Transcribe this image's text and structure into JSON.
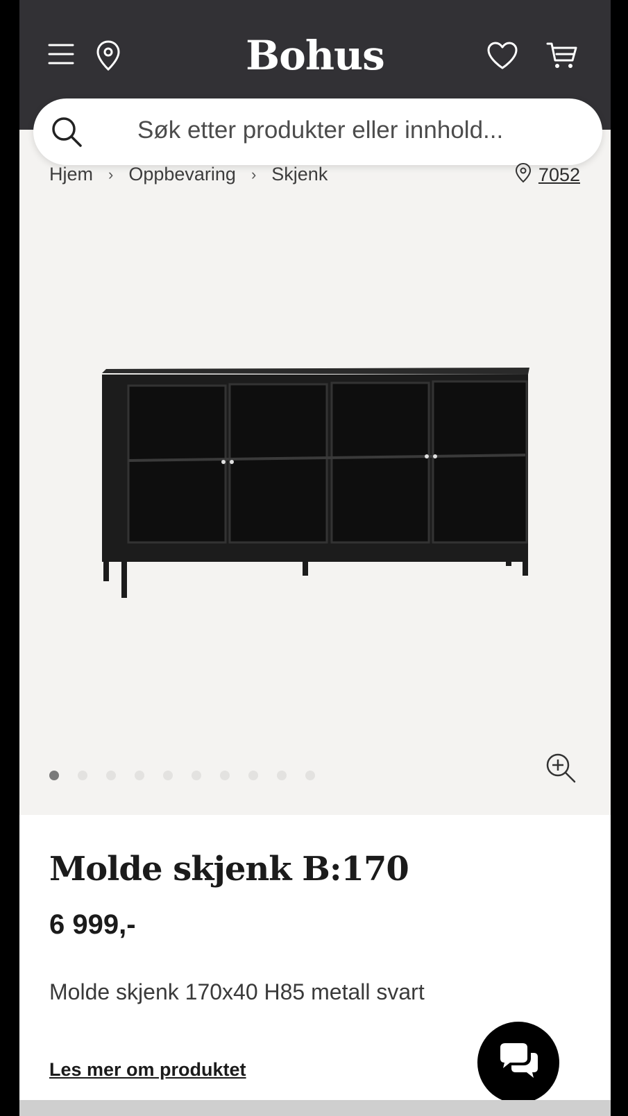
{
  "header": {
    "logo": "Bohus",
    "icons": [
      "menu-icon",
      "location-pin-icon",
      "heart-icon",
      "cart-icon"
    ]
  },
  "search": {
    "placeholder": "Søk etter produkter eller innhold..."
  },
  "breadcrumb": {
    "items": [
      "Hjem",
      "Oppbevaring",
      "Skjenk"
    ],
    "separator": "›"
  },
  "location": {
    "postal_code": "7052"
  },
  "gallery": {
    "image_count": 10,
    "active_index": 0
  },
  "product": {
    "title": "Molde skjenk B:170",
    "price": "6 999,-",
    "description": "Molde skjenk 170x40 H85 metall svart",
    "read_more": "Les mer om produktet"
  },
  "colors": {
    "header_bg": "#323135",
    "page_bg": "#f4f3f1"
  }
}
